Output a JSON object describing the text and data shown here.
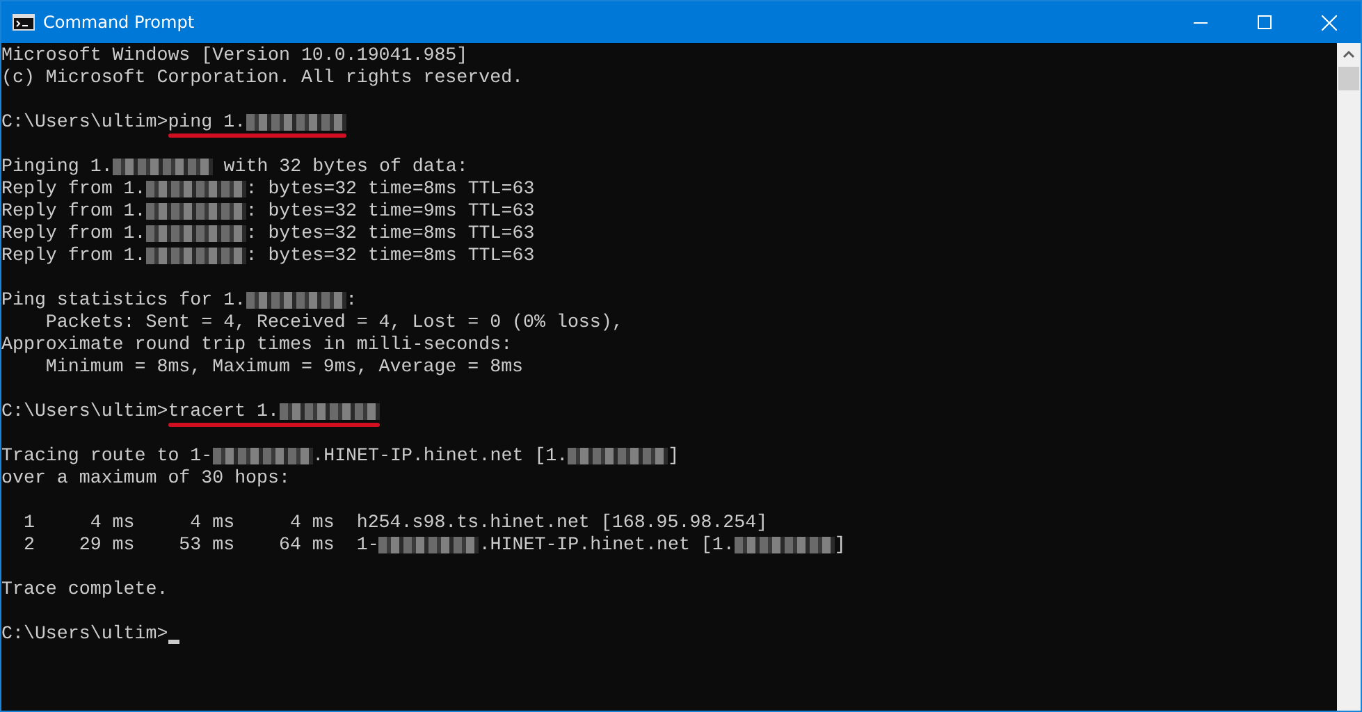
{
  "window": {
    "title": "Command Prompt"
  },
  "lines": [
    {
      "kind": "text",
      "segments": [
        {
          "kind": "text",
          "text": "Microsoft Windows [Version 10.0.19041.985]"
        }
      ]
    },
    {
      "kind": "text",
      "segments": [
        {
          "kind": "text",
          "text": "(c) Microsoft Corporation. All rights reserved."
        }
      ]
    },
    {
      "kind": "blank"
    },
    {
      "kind": "command",
      "prompt": "C:\\Users\\ultim>",
      "underlined": true,
      "segments": [
        {
          "kind": "text",
          "text": "ping 1."
        },
        {
          "kind": "redacted"
        }
      ]
    },
    {
      "kind": "blank"
    },
    {
      "kind": "text",
      "segments": [
        {
          "kind": "text",
          "text": "Pinging 1."
        },
        {
          "kind": "redacted"
        },
        {
          "kind": "text",
          "text": " with 32 bytes of data:"
        }
      ]
    },
    {
      "kind": "text",
      "segments": [
        {
          "kind": "text",
          "text": "Reply from 1."
        },
        {
          "kind": "redacted"
        },
        {
          "kind": "text",
          "text": ": bytes=32 time=8ms TTL=63"
        }
      ]
    },
    {
      "kind": "text",
      "segments": [
        {
          "kind": "text",
          "text": "Reply from 1."
        },
        {
          "kind": "redacted"
        },
        {
          "kind": "text",
          "text": ": bytes=32 time=9ms TTL=63"
        }
      ]
    },
    {
      "kind": "text",
      "segments": [
        {
          "kind": "text",
          "text": "Reply from 1."
        },
        {
          "kind": "redacted"
        },
        {
          "kind": "text",
          "text": ": bytes=32 time=8ms TTL=63"
        }
      ]
    },
    {
      "kind": "text",
      "segments": [
        {
          "kind": "text",
          "text": "Reply from 1."
        },
        {
          "kind": "redacted"
        },
        {
          "kind": "text",
          "text": ": bytes=32 time=8ms TTL=63"
        }
      ]
    },
    {
      "kind": "blank"
    },
    {
      "kind": "text",
      "segments": [
        {
          "kind": "text",
          "text": "Ping statistics for 1."
        },
        {
          "kind": "redacted"
        },
        {
          "kind": "text",
          "text": ":"
        }
      ]
    },
    {
      "kind": "text",
      "segments": [
        {
          "kind": "text",
          "text": "    Packets: Sent = 4, Received = 4, Lost = 0 (0% loss),"
        }
      ]
    },
    {
      "kind": "text",
      "segments": [
        {
          "kind": "text",
          "text": "Approximate round trip times in milli-seconds:"
        }
      ]
    },
    {
      "kind": "text",
      "segments": [
        {
          "kind": "text",
          "text": "    Minimum = 8ms, Maximum = 9ms, Average = 8ms"
        }
      ]
    },
    {
      "kind": "blank"
    },
    {
      "kind": "command",
      "prompt": "C:\\Users\\ultim>",
      "underlined": true,
      "segments": [
        {
          "kind": "text",
          "text": "tracert 1."
        },
        {
          "kind": "redacted"
        }
      ]
    },
    {
      "kind": "blank"
    },
    {
      "kind": "text",
      "segments": [
        {
          "kind": "text",
          "text": "Tracing route to 1-"
        },
        {
          "kind": "redacted"
        },
        {
          "kind": "text",
          "text": ".HINET-IP.hinet.net [1."
        },
        {
          "kind": "redacted"
        },
        {
          "kind": "text",
          "text": "]"
        }
      ]
    },
    {
      "kind": "text",
      "segments": [
        {
          "kind": "text",
          "text": "over a maximum of 30 hops:"
        }
      ]
    },
    {
      "kind": "blank"
    },
    {
      "kind": "text",
      "segments": [
        {
          "kind": "text",
          "text": "  1     4 ms     4 ms     4 ms  h254.s98.ts.hinet.net [168.95.98.254]"
        }
      ]
    },
    {
      "kind": "text",
      "segments": [
        {
          "kind": "text",
          "text": "  2    29 ms    53 ms    64 ms  1-"
        },
        {
          "kind": "redacted"
        },
        {
          "kind": "text",
          "text": ".HINET-IP.hinet.net [1."
        },
        {
          "kind": "redacted"
        },
        {
          "kind": "text",
          "text": "]"
        }
      ]
    },
    {
      "kind": "blank"
    },
    {
      "kind": "text",
      "segments": [
        {
          "kind": "text",
          "text": "Trace complete."
        }
      ]
    },
    {
      "kind": "blank"
    },
    {
      "kind": "command",
      "prompt": "C:\\Users\\ultim>",
      "cursor": true
    }
  ]
}
